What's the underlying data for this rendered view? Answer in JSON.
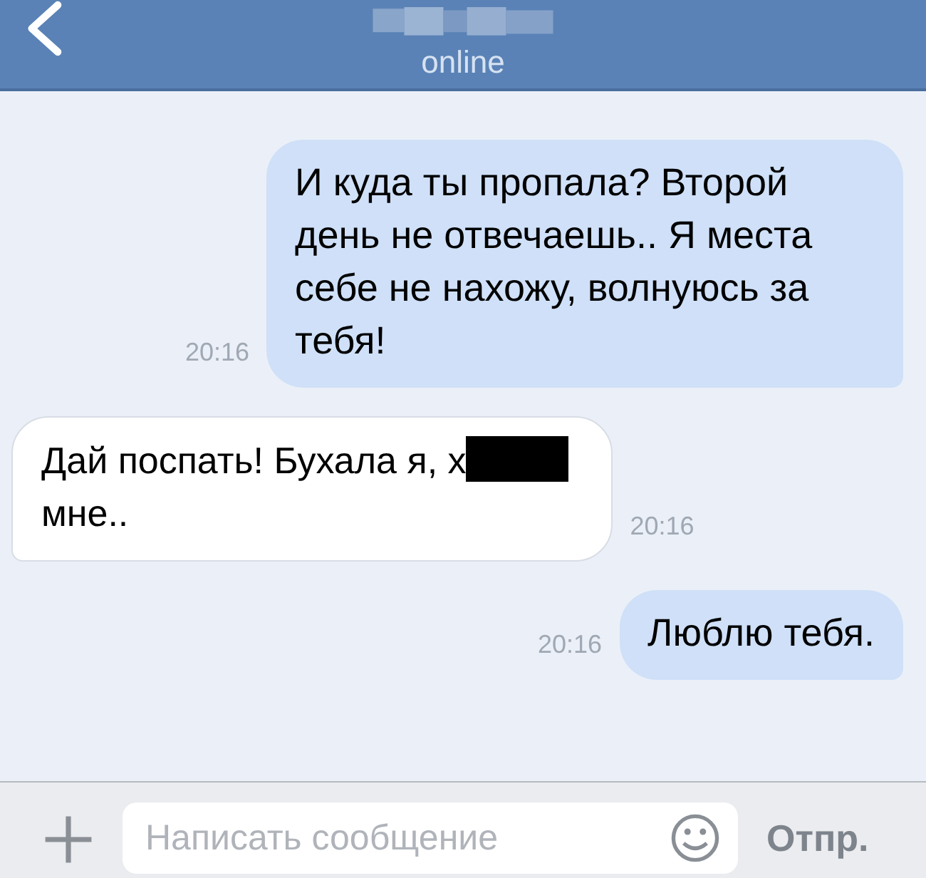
{
  "header": {
    "status": "online"
  },
  "messages": [
    {
      "kind": "outgoing",
      "time": "20:16",
      "lines": [
        [
          {
            "kind": "text",
            "text": "И куда ты пропала? Второй день не отвечаешь.. Я места себе не нахожу, волнуюсь за тебя!"
          }
        ]
      ]
    },
    {
      "kind": "incoming",
      "time": "20:16",
      "lines": [
        [
          {
            "kind": "text",
            "text": "Дай поспать! Бухала я, х"
          },
          {
            "kind": "redacted"
          }
        ],
        [
          {
            "kind": "text",
            "text": "мне.."
          }
        ]
      ]
    },
    {
      "kind": "outgoing",
      "time": "20:16",
      "lines": [
        [
          {
            "kind": "text",
            "text": "Люблю тебя."
          }
        ]
      ]
    }
  ],
  "composer": {
    "placeholder": "Написать сообщение",
    "send": "Отпр."
  }
}
